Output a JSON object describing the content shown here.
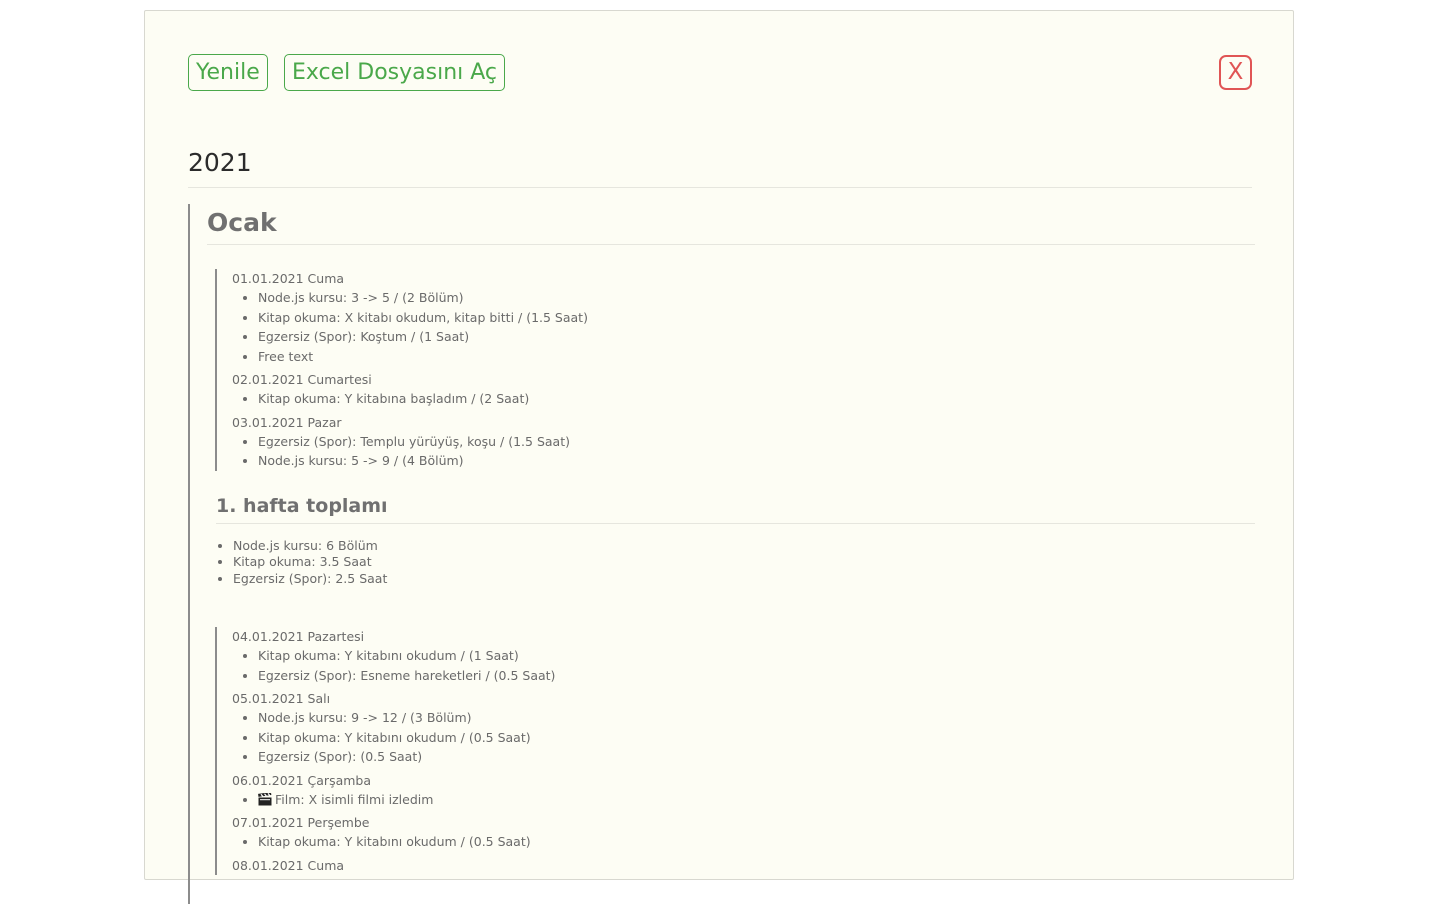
{
  "toolbar": {
    "refresh_label": "Yenile",
    "open_excel_label": "Excel Dosyasını Aç",
    "close_label": "X"
  },
  "year": "2021",
  "month": {
    "title": "Ocak",
    "weeks": [
      {
        "days": [
          {
            "date": "01.01.2021 Cuma",
            "items": [
              "Node.js kursu: 3 -> 5 / (2 Bölüm)",
              "Kitap okuma: X kitabı okudum, kitap bitti / (1.5 Saat)",
              "Egzersiz (Spor): Koştum / (1 Saat)",
              "Free text"
            ]
          },
          {
            "date": "02.01.2021 Cumartesi",
            "items": [
              "Kitap okuma: Y kitabına başladım / (2 Saat)"
            ]
          },
          {
            "date": "03.01.2021 Pazar",
            "items": [
              "Egzersiz (Spor): Templu yürüyüş, koşu / (1.5 Saat)",
              "Node.js kursu: 5 -> 9 / (4 Bölüm)"
            ]
          }
        ],
        "total_title": "1. hafta toplamı",
        "totals": [
          "Node.js kursu: 6 Bölüm",
          "Kitap okuma: 3.5 Saat",
          "Egzersiz (Spor): 2.5 Saat"
        ]
      },
      {
        "days": [
          {
            "date": "04.01.2021 Pazartesi",
            "items": [
              "Kitap okuma: Y kitabını okudum / (1 Saat)",
              "Egzersiz (Spor): Esneme hareketleri / (0.5 Saat)"
            ]
          },
          {
            "date": "05.01.2021 Salı",
            "items": [
              "Node.js kursu: 9 -> 12 / (3 Bölüm)",
              "Kitap okuma: Y kitabını okudum / (0.5 Saat)",
              "Egzersiz (Spor): (0.5 Saat)"
            ]
          },
          {
            "date": "06.01.2021 Çarşamba",
            "items": [
              "Film: X isimli filmi izledim"
            ]
          },
          {
            "date": "07.01.2021 Perşembe",
            "items": [
              "Kitap okuma: Y kitabını okudum / (0.5 Saat)"
            ]
          },
          {
            "date": "08.01.2021 Cuma",
            "items": []
          }
        ]
      }
    ]
  },
  "icons": {
    "film": "clapperboard-icon"
  },
  "colors": {
    "panel_bg": "#fdfdf4",
    "action_green": "#4aa84a",
    "close_red": "#e05555",
    "text_gray": "#6a6a6a"
  }
}
